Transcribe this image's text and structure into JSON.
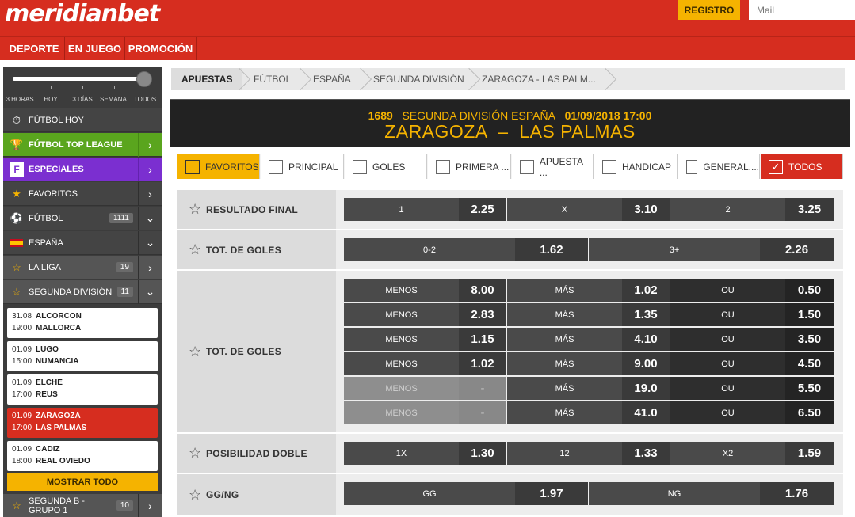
{
  "header": {
    "logo": "meridianbet",
    "register_label": "REGISTRO",
    "mail_placeholder": "Mail"
  },
  "nav": {
    "items": [
      "DEPORTE",
      "EN JUEGO",
      "PROMOCIÓN"
    ]
  },
  "slider": {
    "labels": [
      "3 HORAS",
      "HOY",
      "3 DÍAS",
      "SEMANA",
      "TODOS"
    ],
    "selected": "TODOS"
  },
  "sidebar": {
    "items": [
      {
        "label": "FÚTBOL HOY",
        "icon": "stopwatch-icon"
      },
      {
        "label": "FÚTBOL TOP LEAGUE",
        "icon": "trophy-icon",
        "color": "#5aa51e"
      },
      {
        "label": "ESPECIALES",
        "icon": "specials-icon",
        "color": "#7b2fd0"
      },
      {
        "label": "FAVORITOS",
        "icon": "star-icon"
      },
      {
        "label": "FÚTBOL",
        "icon": "soccer-ball-icon",
        "count": "1111"
      },
      {
        "label": "ESPAÑA",
        "icon": "spain-flag-icon"
      },
      {
        "label": "LA LIGA",
        "icon": "star-outline-icon",
        "count": "19"
      },
      {
        "label": "SEGUNDA DIVISIÓN",
        "icon": "star-outline-icon",
        "count": "11"
      }
    ],
    "matches": [
      {
        "d1": "31.08",
        "t1": "ALCORCON",
        "d2": "19:00",
        "t2": "MALLORCA"
      },
      {
        "d1": "01.09",
        "t1": "LUGO",
        "d2": "15:00",
        "t2": "NUMANCIA"
      },
      {
        "d1": "01.09",
        "t1": "ELCHE",
        "d2": "17:00",
        "t2": "REUS"
      },
      {
        "d1": "01.09",
        "t1": "ZARAGOZA",
        "d2": "17:00",
        "t2": "LAS PALMAS",
        "active": true
      },
      {
        "d1": "01.09",
        "t1": "CADIZ",
        "d2": "18:00",
        "t2": "REAL OVIEDO"
      }
    ],
    "show_all": "MOSTRAR TODO",
    "bottom_item": {
      "label": "SEGUNDA B - GRUPO 1",
      "count": "10"
    }
  },
  "breadcrumb": [
    "APUESTAS",
    "FÚTBOL",
    "ESPAÑA",
    "SEGUNDA DIVISIÓN",
    "ZARAGOZA - LAS PALM..."
  ],
  "event": {
    "id": "1689",
    "league": "SEGUNDA DIVISIÓN ESPAÑA",
    "datetime": "01/09/2018 17:00",
    "teams": "ZARAGOZA  –  LAS PALMAS"
  },
  "filters": [
    "FAVORITOS",
    "PRINCIPAL",
    "GOLES",
    "PRIMERA ...",
    "APUESTA ...",
    "HANDICAP",
    "GENERAL....",
    "TODOS"
  ],
  "markets": [
    {
      "label": "RESULTADO FINAL",
      "rows": [
        [
          [
            "1",
            "2.25"
          ],
          [
            "X",
            "3.10"
          ],
          [
            "2",
            "3.25"
          ]
        ]
      ]
    },
    {
      "label": "TOT. DE GOLES",
      "rows": [
        [
          [
            "0-2",
            "1.62"
          ],
          [
            "3+",
            "2.26"
          ]
        ]
      ]
    },
    {
      "label": "TOT. DE GOLES",
      "rows": [
        [
          [
            "MENOS",
            "8.00"
          ],
          [
            "MÁS",
            "1.02"
          ],
          [
            "OU",
            "0.50"
          ]
        ],
        [
          [
            "MENOS",
            "2.83"
          ],
          [
            "MÁS",
            "1.35"
          ],
          [
            "OU",
            "1.50"
          ]
        ],
        [
          [
            "MENOS",
            "1.15"
          ],
          [
            "MÁS",
            "4.10"
          ],
          [
            "OU",
            "3.50"
          ]
        ],
        [
          [
            "MENOS",
            "1.02"
          ],
          [
            "MÁS",
            "9.00"
          ],
          [
            "OU",
            "4.50"
          ]
        ],
        [
          [
            "MENOS",
            "-"
          ],
          [
            "MÁS",
            "19.0"
          ],
          [
            "OU",
            "5.50"
          ]
        ],
        [
          [
            "MENOS",
            "-"
          ],
          [
            "MÁS",
            "41.0"
          ],
          [
            "OU",
            "6.50"
          ]
        ]
      ]
    },
    {
      "label": "POSIBILIDAD DOBLE",
      "rows": [
        [
          [
            "1X",
            "1.30"
          ],
          [
            "12",
            "1.33"
          ],
          [
            "X2",
            "1.59"
          ]
        ]
      ]
    },
    {
      "label": "GG/NG",
      "rows": [
        [
          [
            "GG",
            "1.97"
          ],
          [
            "NG",
            "1.76"
          ]
        ]
      ]
    }
  ]
}
